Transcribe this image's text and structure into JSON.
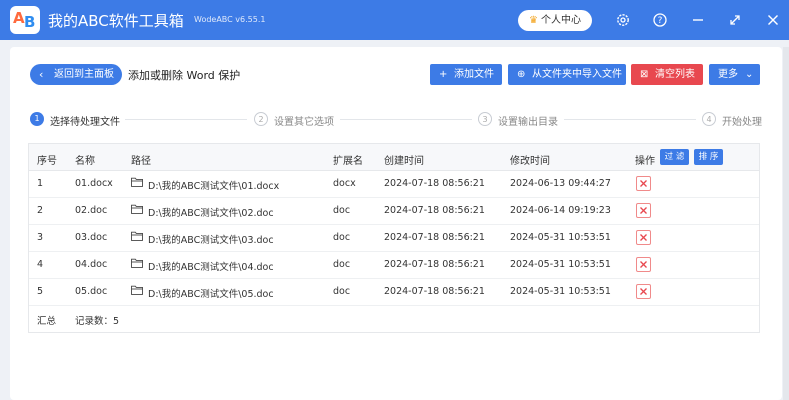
{
  "app": {
    "title": "我的ABC软件工具箱",
    "version": "WodeABC v6.55.1",
    "logo_text_a": "A",
    "logo_text_b": "B",
    "brand_color": "#3d7be6",
    "member_center": "个人中心"
  },
  "titlebar_icons": [
    "gear-icon",
    "help-icon",
    "minimize-icon",
    "maximize-icon",
    "close-icon"
  ],
  "toolbar": {
    "back_label": "返回到主面板",
    "page_title": "添加或删除 Word 保护",
    "add_file": "添加文件",
    "import_folder": "从文件夹中导入文件",
    "clear_list": "清空列表",
    "more": "更多"
  },
  "steps": [
    {
      "num": "1",
      "label": "选择待处理文件"
    },
    {
      "num": "2",
      "label": "设置其它选项"
    },
    {
      "num": "3",
      "label": "设置输出目录"
    },
    {
      "num": "4",
      "label": "开始处理"
    }
  ],
  "table": {
    "columns": [
      "序号",
      "名称",
      "路径",
      "扩展名",
      "创建时间",
      "修改时间",
      "操作"
    ],
    "filter_btn": "过 滤",
    "sort_btn": "排 序",
    "rows": [
      {
        "idx": "1",
        "name": "01.docx",
        "path": "D:\\我的ABC测试文件\\01.docx",
        "ext": "docx",
        "created": "2024-07-18 08:56:21",
        "modified": "2024-06-13 09:44:27"
      },
      {
        "idx": "2",
        "name": "02.doc",
        "path": "D:\\我的ABC测试文件\\02.doc",
        "ext": "doc",
        "created": "2024-07-18 08:56:21",
        "modified": "2024-06-14 09:19:23"
      },
      {
        "idx": "3",
        "name": "03.doc",
        "path": "D:\\我的ABC测试文件\\03.doc",
        "ext": "doc",
        "created": "2024-07-18 08:56:21",
        "modified": "2024-05-31 10:53:51"
      },
      {
        "idx": "4",
        "name": "04.doc",
        "path": "D:\\我的ABC测试文件\\04.doc",
        "ext": "doc",
        "created": "2024-07-18 08:56:21",
        "modified": "2024-05-31 10:53:51"
      },
      {
        "idx": "5",
        "name": "05.doc",
        "path": "D:\\我的ABC测试文件\\05.doc",
        "ext": "doc",
        "created": "2024-07-18 08:56:21",
        "modified": "2024-05-31 10:53:51"
      }
    ],
    "summary_label": "汇总",
    "record_count": "记录数：5"
  }
}
